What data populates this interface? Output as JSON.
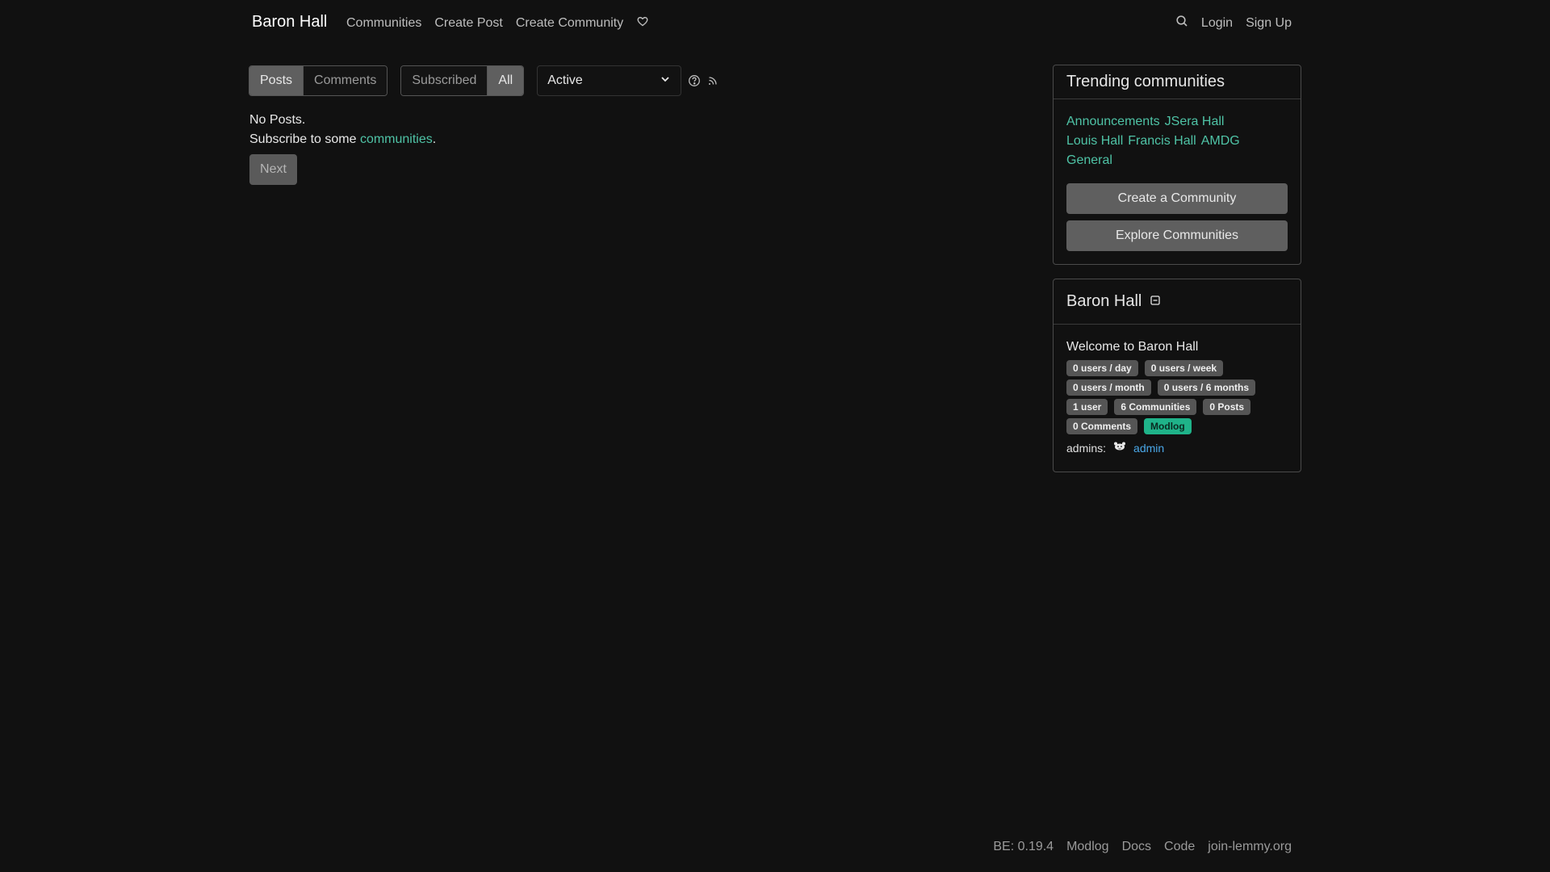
{
  "nav": {
    "brand": "Baron Hall",
    "links": [
      "Communities",
      "Create Post",
      "Create Community"
    ],
    "login": "Login",
    "signup": "Sign Up"
  },
  "toolbar": {
    "listing_type": [
      "Posts",
      "Comments"
    ],
    "feed": [
      "Subscribed",
      "All"
    ],
    "sort_selected": "Active"
  },
  "main": {
    "no_posts": "No Posts.",
    "subscribe_prefix": "Subscribe to some ",
    "subscribe_link": "communities",
    "subscribe_suffix": ".",
    "next": "Next"
  },
  "trending": {
    "title": "Trending communities",
    "communities": [
      "Announcements",
      "JSera Hall",
      "Louis Hall",
      "Francis Hall",
      "AMDG",
      "General"
    ],
    "create_button": "Create a Community",
    "explore_button": "Explore Communities"
  },
  "site": {
    "title": "Baron Hall",
    "welcome": "Welcome to Baron Hall",
    "badges": [
      "0 users / day",
      "0 users / week",
      "0 users / month",
      "0 users / 6 months",
      "1 user",
      "6 Communities",
      "0 Posts",
      "0 Comments"
    ],
    "modlog": "Modlog",
    "admins_label": "admins:",
    "admin_name": "admin"
  },
  "footer": {
    "version": "BE: 0.19.4",
    "links": [
      "Modlog",
      "Docs",
      "Code",
      "join-lemmy.org"
    ]
  },
  "colors": {
    "background": "#111111",
    "accent": "#4fc3a6",
    "link_blue": "#4aa8e8",
    "button_gray": "#5f5f5f",
    "modlog_green": "#1fb389"
  }
}
